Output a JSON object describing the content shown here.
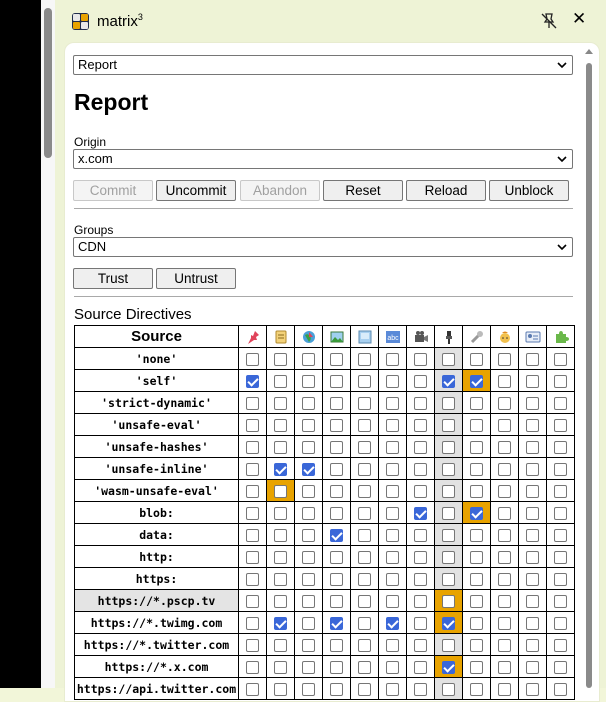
{
  "app": {
    "name": "matrix",
    "superscript": "3",
    "icon": "matrix-grid-icon",
    "header_icons": [
      "unpin-icon",
      "close-icon"
    ]
  },
  "view_select": {
    "value": "Report"
  },
  "report_title": "Report",
  "origin": {
    "label": "Origin",
    "value": "x.com"
  },
  "actions": [
    "Commit",
    "Uncommit",
    "Abandon",
    "Reset",
    "Reload",
    "Unblock"
  ],
  "actions_disabled": [
    "Commit",
    "Abandon"
  ],
  "groups": {
    "label": "Groups",
    "value": "CDN"
  },
  "group_actions": [
    "Trust",
    "Untrust"
  ],
  "section_title": "Source Directives",
  "matrix": {
    "source_header": "Source",
    "columns": [
      "pin-icon",
      "script-scroll-icon",
      "globe-icon",
      "image-icon",
      "frame-icon",
      "font-icon",
      "media-icon",
      "connect-plug-icon",
      "worker-wrench-icon",
      "child-face-icon",
      "manifest-card-icon",
      "plugin-puzzle-icon"
    ],
    "rows": [
      {
        "source": "'none'",
        "checked": [],
        "highlight": []
      },
      {
        "source": "'self'",
        "checked": [
          0,
          7,
          8
        ],
        "highlight": [
          8
        ]
      },
      {
        "source": "'strict-dynamic'",
        "checked": [],
        "highlight": []
      },
      {
        "source": "'unsafe-eval'",
        "checked": [],
        "highlight": []
      },
      {
        "source": "'unsafe-hashes'",
        "checked": [],
        "highlight": []
      },
      {
        "source": "'unsafe-inline'",
        "checked": [
          1,
          2
        ],
        "highlight": []
      },
      {
        "source": "'wasm-unsafe-eval'",
        "checked": [],
        "highlight": [
          1
        ]
      },
      {
        "source": "blob:",
        "checked": [
          6,
          8
        ],
        "highlight": [
          8
        ]
      },
      {
        "source": "data:",
        "checked": [
          3
        ],
        "highlight": []
      },
      {
        "source": "http:",
        "checked": [],
        "highlight": []
      },
      {
        "source": "https:",
        "checked": [],
        "highlight": []
      },
      {
        "source": "https://*.pscp.tv",
        "checked": [],
        "highlight": [
          7
        ],
        "grey": true
      },
      {
        "source": "https://*.twimg.com",
        "checked": [
          1,
          3,
          5,
          7
        ],
        "highlight": [
          7
        ]
      },
      {
        "source": "https://*.twitter.com",
        "checked": [],
        "highlight": []
      },
      {
        "source": "https://*.x.com",
        "checked": [
          7
        ],
        "highlight": [
          7
        ]
      },
      {
        "source": "https://api.twitter.com",
        "checked": [],
        "highlight": []
      }
    ],
    "shaded_column": 7
  }
}
